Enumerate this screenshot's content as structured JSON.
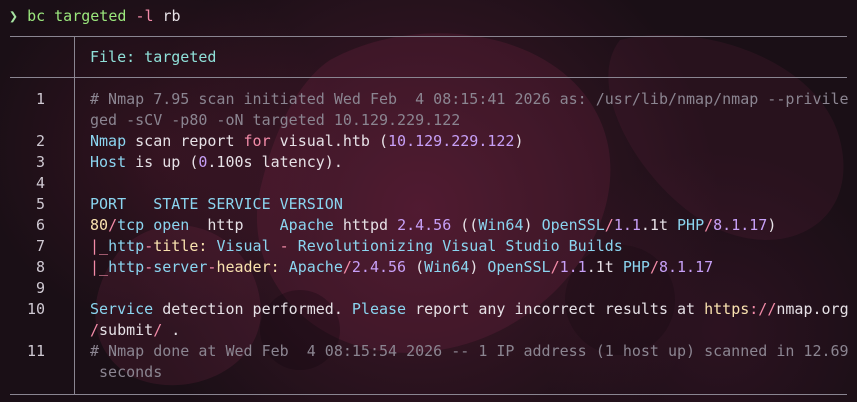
{
  "prompt": {
    "symbol": "❯",
    "command": "bc",
    "target": "targeted",
    "flag": "-l",
    "flag_arg": "rb"
  },
  "file": {
    "header": "File: targeted"
  },
  "lines": [
    {
      "n": "1",
      "segments": [
        {
          "t": "# Nmap 7.95 scan initiated Wed Feb  4 08:15:41 2026 as: /usr/lib/nmap/nmap --privile",
          "c": "cm"
        }
      ]
    },
    {
      "n": "",
      "segments": [
        {
          "t": "ged -sCV -p80 -oN targeted 10.129.229.122",
          "c": "cm"
        }
      ]
    },
    {
      "n": "2",
      "segments": [
        {
          "t": "Nmap ",
          "c": "cy"
        },
        {
          "t": "scan ",
          "c": "wh"
        },
        {
          "t": "report ",
          "c": "wh"
        },
        {
          "t": "for ",
          "c": "pk"
        },
        {
          "t": "visual.htb ",
          "c": "wh"
        },
        {
          "t": "(",
          "c": "wh"
        },
        {
          "t": "10.129.229.122",
          "c": "pu"
        },
        {
          "t": ")",
          "c": "wh"
        }
      ]
    },
    {
      "n": "3",
      "segments": [
        {
          "t": "Host ",
          "c": "cy"
        },
        {
          "t": "is up (",
          "c": "wh"
        },
        {
          "t": "0",
          "c": "pu"
        },
        {
          "t": ".100s latency).",
          "c": "wh"
        }
      ]
    },
    {
      "n": "4",
      "segments": []
    },
    {
      "n": "5",
      "segments": [
        {
          "t": "PORT   STATE SERVICE VERSION",
          "c": "cy"
        }
      ]
    },
    {
      "n": "6",
      "segments": [
        {
          "t": "80",
          "c": "ye"
        },
        {
          "t": "/",
          "c": "pk"
        },
        {
          "t": "tcp ",
          "c": "cy"
        },
        {
          "t": "open  ",
          "c": "cy"
        },
        {
          "t": "http    ",
          "c": "wh"
        },
        {
          "t": "Apache ",
          "c": "cy"
        },
        {
          "t": "httpd ",
          "c": "wh"
        },
        {
          "t": "2.4.56 ",
          "c": "pu"
        },
        {
          "t": "((",
          "c": "wh"
        },
        {
          "t": "Win64",
          "c": "cy"
        },
        {
          "t": ") ",
          "c": "wh"
        },
        {
          "t": "OpenSSL",
          "c": "cy"
        },
        {
          "t": "/",
          "c": "pk"
        },
        {
          "t": "1.1",
          "c": "pu"
        },
        {
          "t": ".1t ",
          "c": "wh"
        },
        {
          "t": "PHP",
          "c": "cy"
        },
        {
          "t": "/",
          "c": "pk"
        },
        {
          "t": "8.1.17",
          "c": "pu"
        },
        {
          "t": ")",
          "c": "wh"
        }
      ]
    },
    {
      "n": "7",
      "segments": [
        {
          "t": "|_",
          "c": "pk"
        },
        {
          "t": "http",
          "c": "cy"
        },
        {
          "t": "-",
          "c": "pk"
        },
        {
          "t": "title: ",
          "c": "ye"
        },
        {
          "t": "Visual ",
          "c": "cy"
        },
        {
          "t": "- ",
          "c": "pk"
        },
        {
          "t": "Revolutionizing Visual Studio Builds",
          "c": "cy"
        }
      ]
    },
    {
      "n": "8",
      "segments": [
        {
          "t": "|_",
          "c": "pk"
        },
        {
          "t": "http",
          "c": "cy"
        },
        {
          "t": "-",
          "c": "pk"
        },
        {
          "t": "server",
          "c": "cy"
        },
        {
          "t": "-",
          "c": "pk"
        },
        {
          "t": "header: ",
          "c": "ye"
        },
        {
          "t": "Apache",
          "c": "cy"
        },
        {
          "t": "/",
          "c": "pk"
        },
        {
          "t": "2.4.56 ",
          "c": "pu"
        },
        {
          "t": "(",
          "c": "wh"
        },
        {
          "t": "Win64",
          "c": "cy"
        },
        {
          "t": ") ",
          "c": "wh"
        },
        {
          "t": "OpenSSL",
          "c": "cy"
        },
        {
          "t": "/",
          "c": "pk"
        },
        {
          "t": "1.1",
          "c": "pu"
        },
        {
          "t": ".1t ",
          "c": "wh"
        },
        {
          "t": "PHP",
          "c": "cy"
        },
        {
          "t": "/",
          "c": "pk"
        },
        {
          "t": "8.1.17",
          "c": "pu"
        }
      ]
    },
    {
      "n": "9",
      "segments": []
    },
    {
      "n": "10",
      "segments": [
        {
          "t": "Service ",
          "c": "cy"
        },
        {
          "t": "detection performed. ",
          "c": "wh"
        },
        {
          "t": "Please ",
          "c": "cy"
        },
        {
          "t": "report any incorrect results at ",
          "c": "wh"
        },
        {
          "t": "https",
          "c": "ye"
        },
        {
          "t": "://",
          "c": "pk"
        },
        {
          "t": "nmap.org",
          "c": "wh"
        }
      ]
    },
    {
      "n": "",
      "segments": [
        {
          "t": "/",
          "c": "pk"
        },
        {
          "t": "submit",
          "c": "wh"
        },
        {
          "t": "/ ",
          "c": "pk"
        },
        {
          "t": ".",
          "c": "wh"
        }
      ]
    },
    {
      "n": "11",
      "segments": [
        {
          "t": "# Nmap done at Wed Feb  4 08:15:54 2026 -- 1 IP address (1 host up) scanned in 12.69",
          "c": "cm"
        }
      ]
    },
    {
      "n": "",
      "segments": [
        {
          "t": " seconds",
          "c": "cm"
        }
      ]
    }
  ]
}
